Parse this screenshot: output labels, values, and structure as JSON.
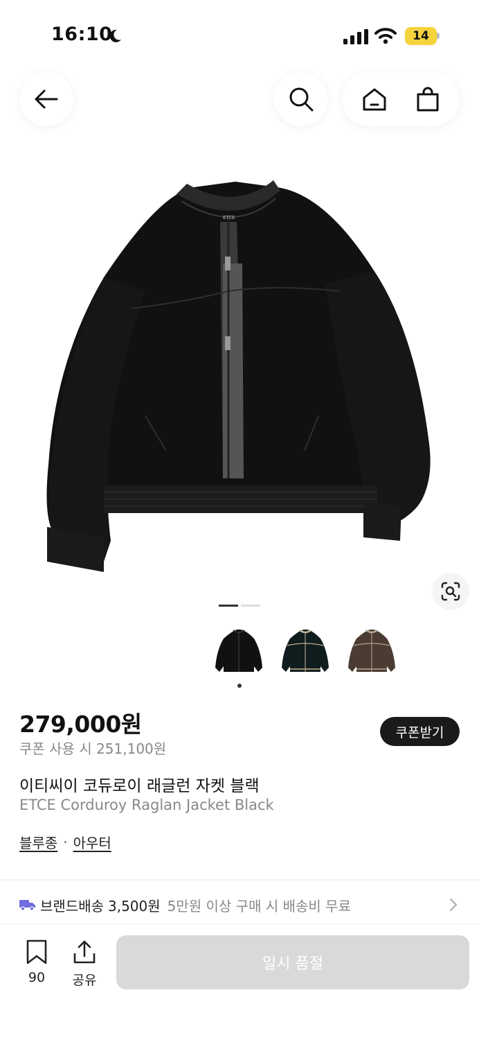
{
  "status_bar": {
    "time": "16:10",
    "battery": "14"
  },
  "product": {
    "price": "279,000원",
    "coupon_price": "쿠폰 사용 시 251,100원",
    "coupon_button": "쿠폰받기",
    "name_kr": "이티씨이 코듀로이 래글런 자켓 블랙",
    "name_en": "ETCE Corduroy Raglan Jacket Black",
    "categories": [
      "블루종",
      "아우터"
    ],
    "category_separator": "·",
    "image_label": "ETCE"
  },
  "gallery": {
    "pages": 2,
    "current": 1
  },
  "thumbnails": [
    {
      "name": "black",
      "color": "#111111",
      "trim": "#2a2a2a"
    },
    {
      "name": "navy",
      "color": "#0f1d1e",
      "trim": "#c8b49a"
    },
    {
      "name": "brown",
      "color": "#4a3c33",
      "trim": "#b8a893"
    }
  ],
  "shipping": {
    "label": "브랜드배송",
    "fee": "3,500원",
    "note": "5만원 이상 구매 시 배송비 무료"
  },
  "bottom_bar": {
    "bookmark_count": "90",
    "share_label": "공유",
    "soldout_label": "일시 품절"
  },
  "colors": {
    "accent": "#6e6ce0",
    "dark": "#1a1a1a",
    "muted": "#888888"
  }
}
